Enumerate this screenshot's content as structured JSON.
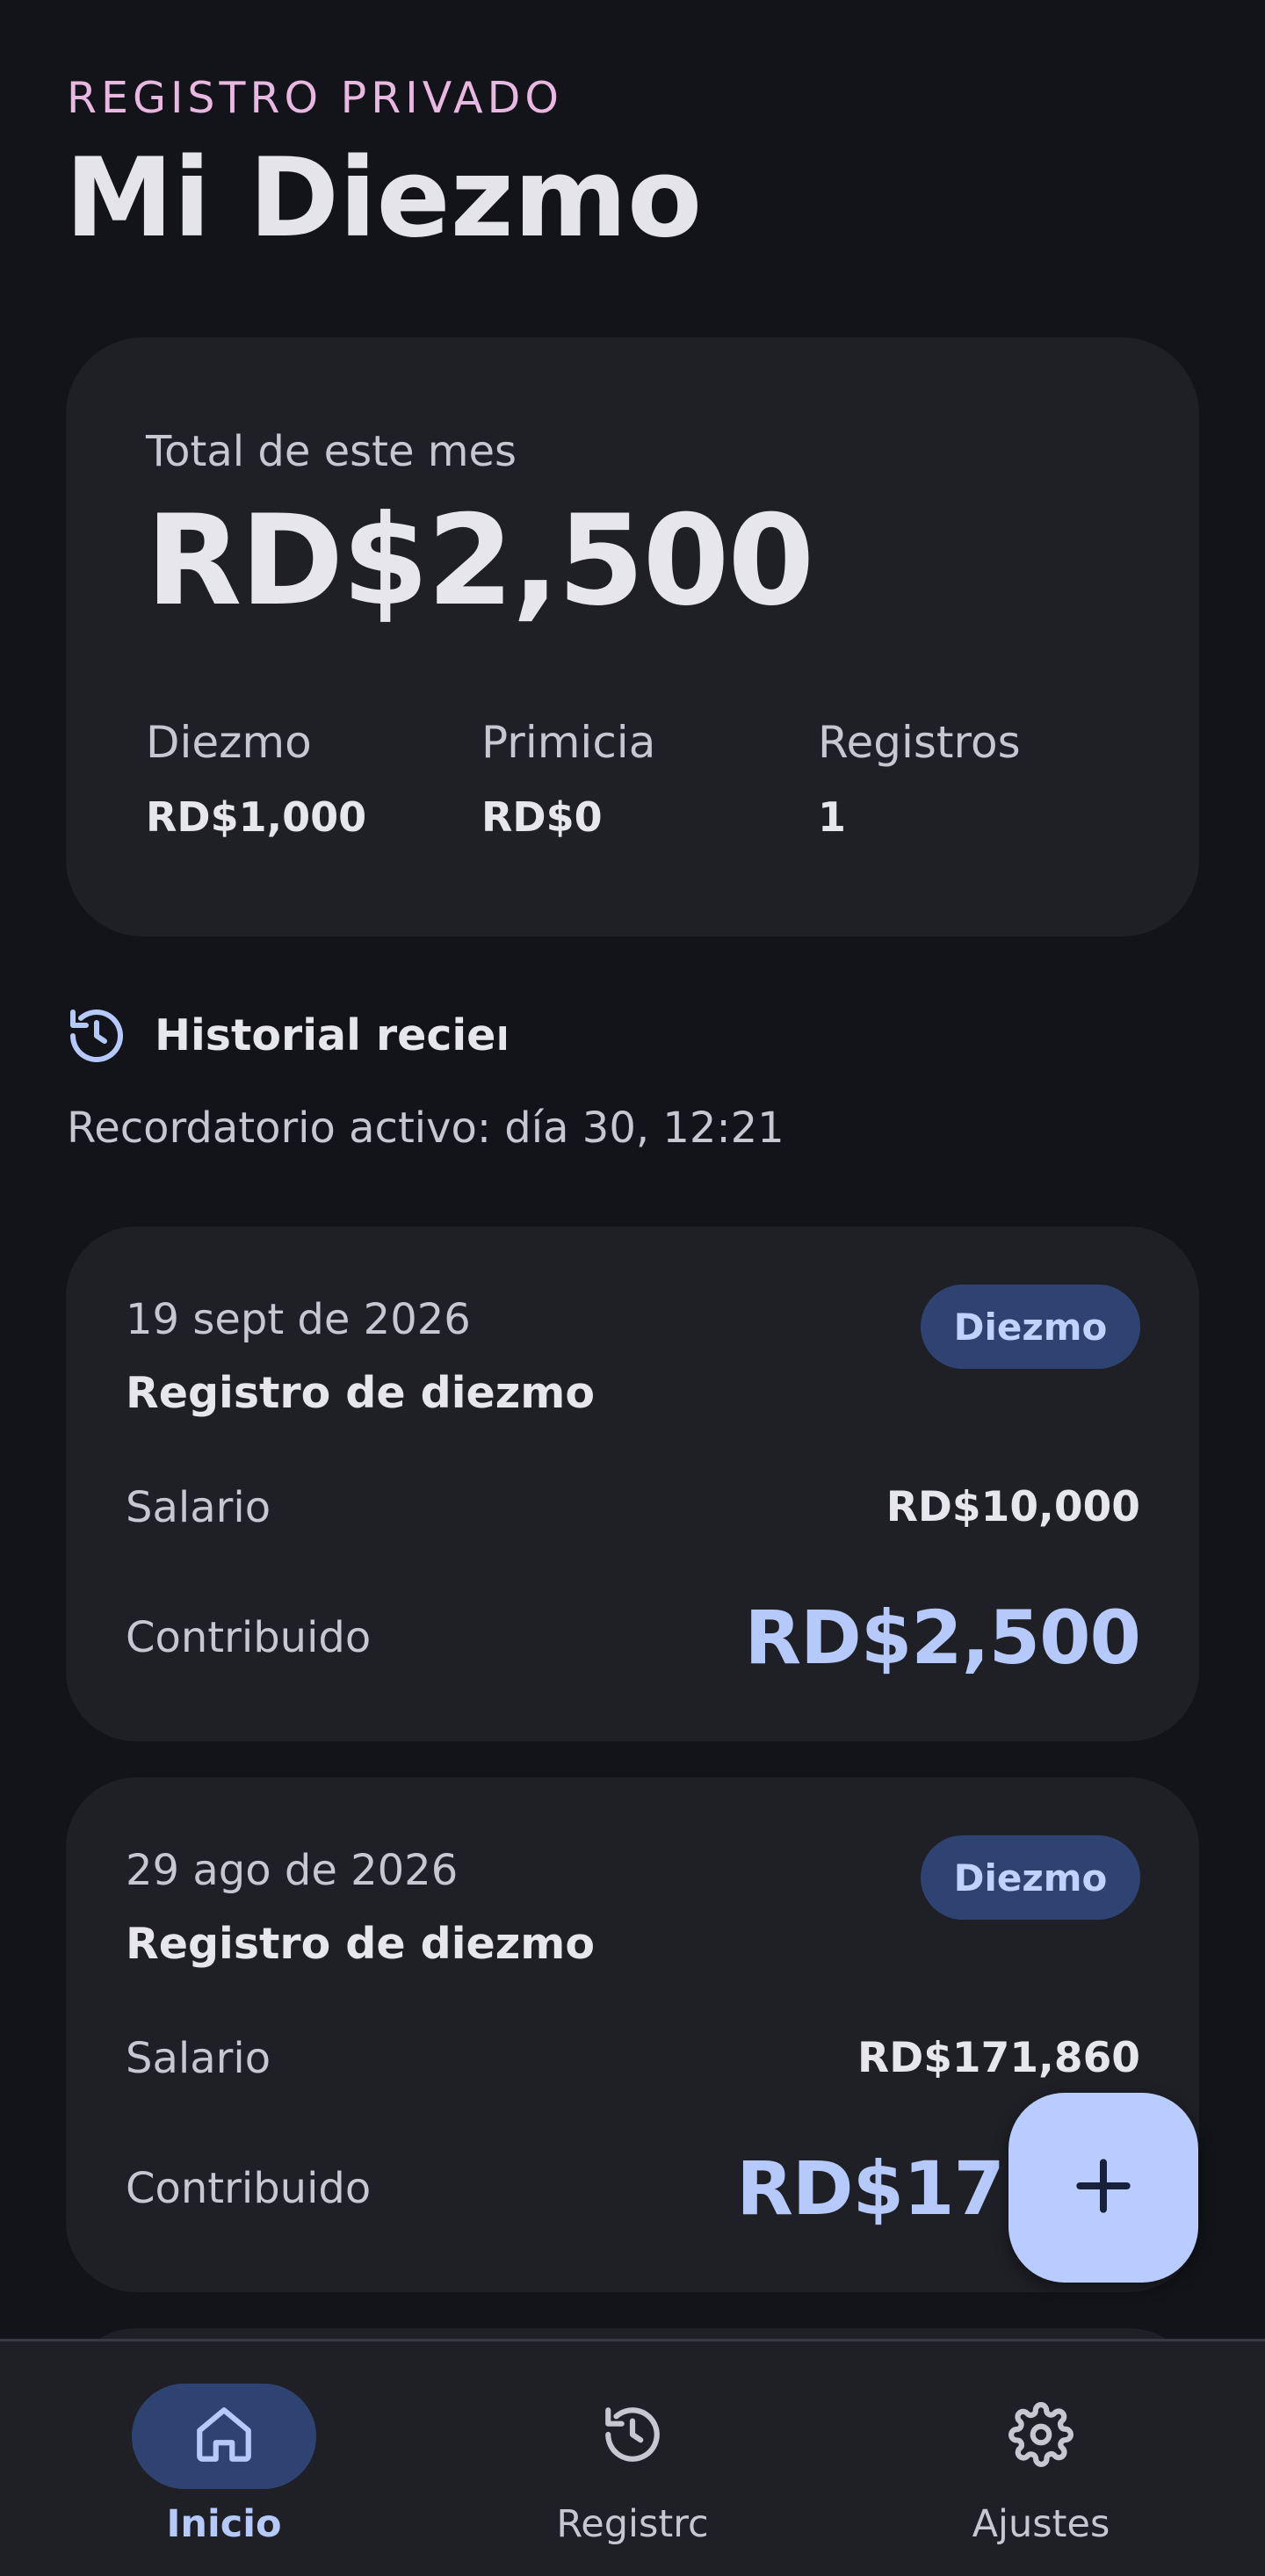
{
  "header": {
    "eyebrow": "REGISTRO PRIVADO",
    "title": "Mi Diezmo"
  },
  "summary": {
    "label": "Total de este mes",
    "total": "RD$2,500",
    "stats": [
      {
        "label": "Diezmo",
        "value": "RD$1,000"
      },
      {
        "label": "Primicia",
        "value": "RD$0"
      },
      {
        "label": "Registros",
        "value": "1"
      }
    ]
  },
  "history": {
    "title": "Historial recient",
    "icon": "history-icon",
    "reminder": "Recordatorio activo: día 30, 12:21"
  },
  "records": [
    {
      "date": "19 sept de 2026",
      "title": "Registro de diezmo",
      "badge": "Diezmo",
      "salary_label": "Salario",
      "salary": "RD$10,000",
      "contributed_label": "Contribuido",
      "contributed": "RD$2,500"
    },
    {
      "date": "29 ago de 2026",
      "title": "Registro de diezmo",
      "badge": "Diezmo",
      "salary_label": "Salario",
      "salary": "RD$171,860",
      "contributed_label": "Contribuido",
      "contributed": "RD$17"
    }
  ],
  "fab": {
    "icon": "plus-icon"
  },
  "nav": {
    "items": [
      {
        "label": "Inicio",
        "icon": "home-icon",
        "active": true
      },
      {
        "label": "Registrc",
        "icon": "history-icon",
        "active": false
      },
      {
        "label": "Ajustes",
        "icon": "gear-icon",
        "active": false
      }
    ]
  },
  "colors": {
    "background": "#131419",
    "card": "#1f2026",
    "accent": "#b6c9fb",
    "badge_bg": "#2f4373",
    "eyebrow": "#e9b8e1",
    "fab": "#b8ccff"
  }
}
